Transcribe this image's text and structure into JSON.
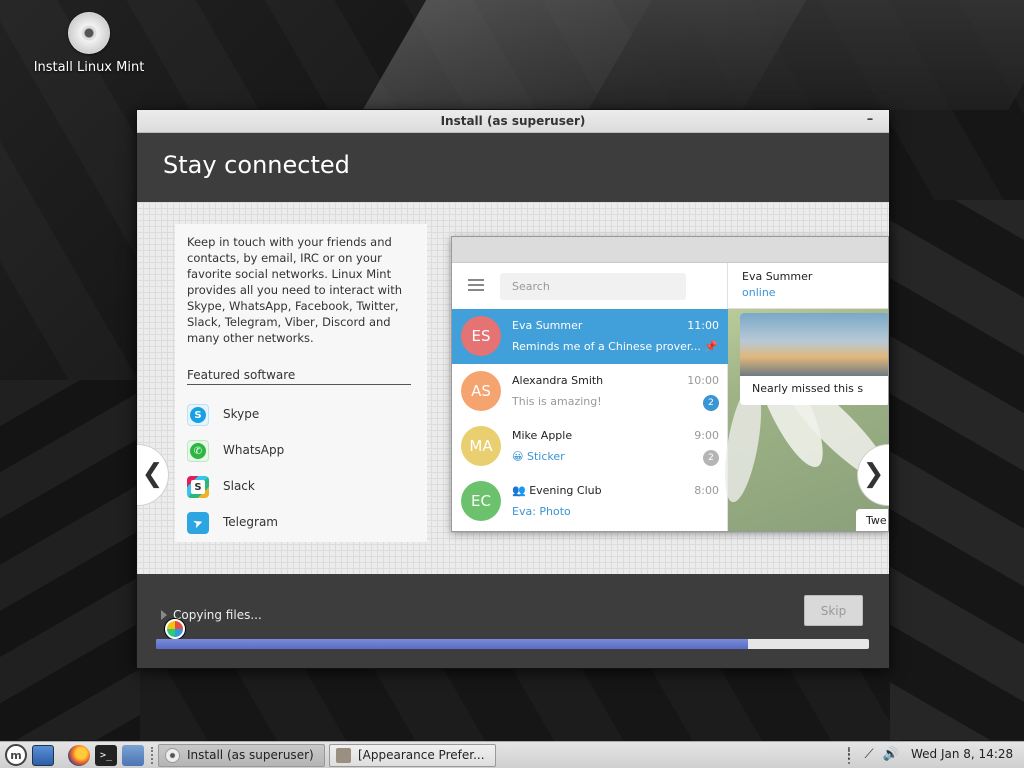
{
  "desktop": {
    "icon_label": "Install Linux Mint"
  },
  "window": {
    "title": "Install (as superuser)",
    "minimize_glyph": "–",
    "slide_title": "Stay connected",
    "description": "Keep in touch with your friends and contacts, by email, IRC or on your favorite social networks. Linux Mint provides all you need to interact with Skype, WhatsApp, Facebook, Twitter, Slack, Telegram, Viber, Discord and many other networks.",
    "featured_heading": "Featured software",
    "software": [
      {
        "label": "Skype",
        "icon": "skype-icon"
      },
      {
        "label": "WhatsApp",
        "icon": "whatsapp-icon"
      },
      {
        "label": "Slack",
        "icon": "slack-icon"
      },
      {
        "label": "Telegram",
        "icon": "telegram-icon"
      }
    ],
    "prev_arrow": "❮",
    "next_arrow": "❯",
    "progress_text": "Copying files...",
    "skip_label": "Skip",
    "progress_fraction": 0.83
  },
  "telegram": {
    "search_placeholder": "Search",
    "chats": [
      {
        "initials": "ES",
        "name": "Eva Summer",
        "time": "11:00",
        "message": "Reminds me of a Chinese prover...",
        "color": "#e57373",
        "pinned": true
      },
      {
        "initials": "AS",
        "name": "Alexandra Smith",
        "time": "10:00",
        "message": "This is amazing!",
        "color": "#f5a36f",
        "badge": "2",
        "badge_color": "#3a95d5"
      },
      {
        "initials": "MA",
        "name": "Mike Apple",
        "time": "9:00",
        "message": "😀 Sticker",
        "color": "#e9cf6f",
        "badge": "2",
        "badge_color": "#b5b5b5"
      },
      {
        "initials": "EC",
        "name": "Evening Club",
        "time": "8:00",
        "message": "Eva: Photo",
        "color": "#6cc26c"
      }
    ],
    "group_glyph": "👥",
    "pin_glyph": "📌",
    "header_name": "Eva Summer",
    "header_status": "online",
    "message_text": "Nearly missed this s",
    "small_message": "Twe"
  },
  "taskbar": {
    "menu_glyph": "m",
    "terminal_glyph": ">_",
    "tasks": [
      {
        "label": "Install (as superuser)"
      },
      {
        "label": "[Appearance Prefer..."
      }
    ],
    "tray_glyphs": {
      "notes": "⋮",
      "network": "⟋",
      "volume": "🔊"
    },
    "clock": "Wed Jan  8, 14:28"
  }
}
